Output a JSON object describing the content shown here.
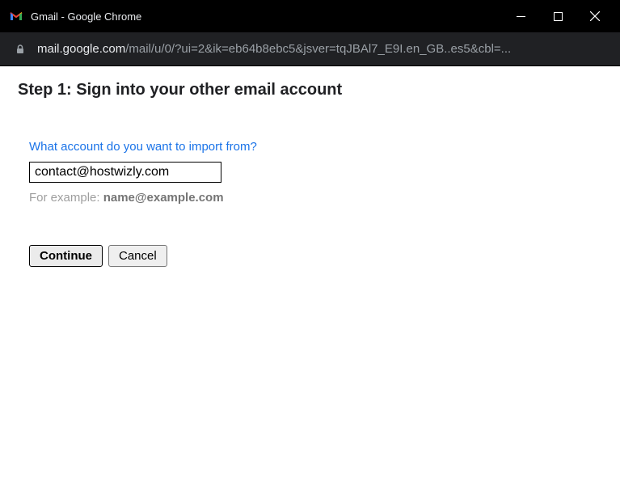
{
  "window": {
    "title": "Gmail - Google Chrome"
  },
  "address": {
    "host": "mail.google.com",
    "path": "/mail/u/0/?ui=2&ik=eb64b8ebc5&jsver=tqJBAl7_E9I.en_GB..es5&cbl=..."
  },
  "page": {
    "title": "Step 1: Sign into your other email account",
    "prompt": "What account do you want to import from?",
    "email_value": "contact@hostwizly.com",
    "example_prefix": "For example: ",
    "example_email": "name@example.com",
    "continue_label": "Continue",
    "cancel_label": "Cancel"
  }
}
